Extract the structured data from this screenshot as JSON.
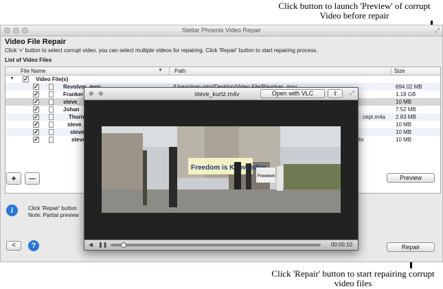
{
  "annotations": {
    "preview_note": "Click button to launch 'Preview' of corrupt Video before repair",
    "repair_note": "Click 'Repair' button to start repairing corrupt video files"
  },
  "window": {
    "title": "Stellar Phoenix Video Repair",
    "resize_glyph": "⤢"
  },
  "main": {
    "heading": "Video File Repair",
    "instructions": "Click '+' button to select corrupt video. you can select multiple videos for repairing. Click 'Repair' button to start repairing process.",
    "list_label": "List of Video Files"
  },
  "table": {
    "columns": {
      "name": "File Name",
      "path": "Path",
      "size": "Size"
    },
    "group_label": "Video File(s)",
    "rows": [
      {
        "name": "Revolver .mov",
        "path": "/Users/mac-mini/Desktop/Video File/Revolver .mov",
        "size": "694.02 MB"
      },
      {
        "name": "Franker",
        "path": "",
        "size": "1.18 GB"
      },
      {
        "name": "steve_",
        "path": "",
        "size": "10 MB"
      },
      {
        "name": "Johan",
        "path": "",
        "size": "7.52 MB"
      },
      {
        "name": "Thorn",
        "path": "cept.m4a",
        "size": "2.83 MB"
      },
      {
        "name": "steve_",
        "path": "",
        "size": "10 MB"
      },
      {
        "name": "steve",
        "path": "",
        "size": "10 MB"
      },
      {
        "name": "steve",
        "path": "4v",
        "size": "10 MB"
      }
    ]
  },
  "buttons": {
    "add": "+",
    "remove": "—",
    "preview": "Preview",
    "repair": "Repair",
    "back": "<"
  },
  "info": {
    "line1": "Click 'Repair' button",
    "line2": "Note: Partial preview"
  },
  "preview": {
    "title": "steve_kurtz.m4v",
    "open_vlc": "Open with VLC",
    "share_glyph": "⇪",
    "resize_glyph": "⤢",
    "timecode": "00:00:10",
    "progress": 0.05,
    "sign_main": "Freedom is Knowledge",
    "sign_small": "Freedom"
  },
  "colors": {
    "accent_blue": "#2b74d8",
    "selected_row": "#d7d7d7",
    "sign_yellow": "#f3f0c4"
  }
}
